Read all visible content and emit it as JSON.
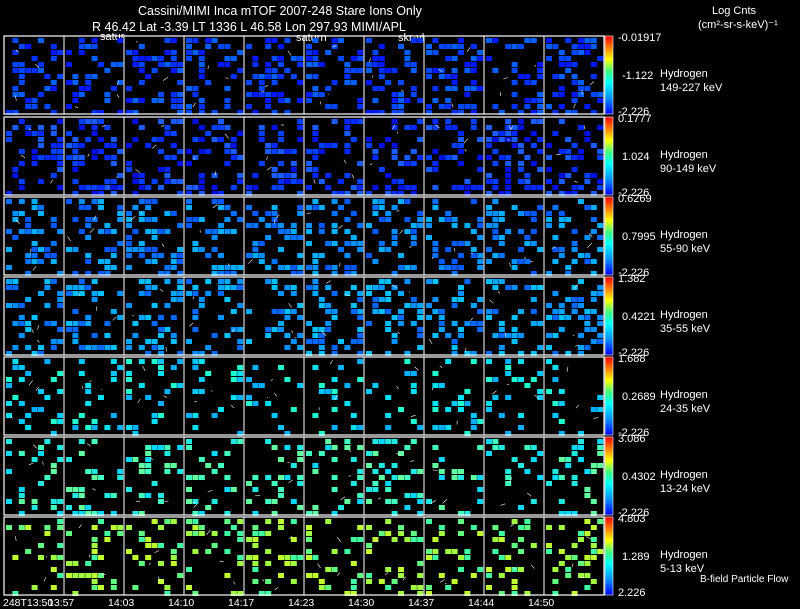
{
  "header": {
    "title": "Cassini/MIMI Inca mTOF  2007-248   Stare   Ions Only",
    "pos_line": "R         46.42 Lat -3.39 LT 1336 L         46.58 Lon         297.93  MIMI/APL",
    "cb_title": "Log Cnts",
    "cb_units": "(cm²-sr-s-keV)⁻¹",
    "marks": [
      "satur",
      "saturn",
      "skr-vl"
    ]
  },
  "footer": {
    "bfield": "B-field Particle Flow"
  },
  "colors": {
    "background": "#000000",
    "grid": "#ffffff",
    "text": "#ffffff"
  },
  "chart_data": {
    "type": "heatmap",
    "time_ticks": [
      "248T13:50",
      "13:57",
      "14:03",
      "14:10",
      "14:17",
      "14:23",
      "14:30",
      "14:37",
      "14:44",
      "14:50"
    ],
    "panels": [
      {
        "species": "Hydrogen",
        "energy": "149-227 keV",
        "cb_max": "-0.01917",
        "cb_mid": "-1.122",
        "cb_min": "-2.226"
      },
      {
        "species": "Hydrogen",
        "energy": "90-149 keV",
        "cb_max": "0.1777",
        "cb_mid": "1.024",
        "cb_min": "-2.226"
      },
      {
        "species": "Hydrogen",
        "energy": "55-90 keV",
        "cb_max": "0.6269",
        "cb_mid": "0.7995",
        "cb_min": "-2.226"
      },
      {
        "species": "Hydrogen",
        "energy": "35-55 keV",
        "cb_max": "1.382",
        "cb_mid": "0.4221",
        "cb_min": "-2.226"
      },
      {
        "species": "Hydrogen",
        "energy": "24-35 keV",
        "cb_max": "1.688",
        "cb_mid": "0.2689",
        "cb_min": "-2.226"
      },
      {
        "species": "Hydrogen",
        "energy": "13-24 keV",
        "cb_max": "3.086",
        "cb_mid": "0.4302",
        "cb_min": "-2.226"
      },
      {
        "species": "Hydrogen",
        "energy": "5-13 keV",
        "cb_max": "4.803",
        "cb_mid": "1.289",
        "cb_min": "2.226"
      }
    ]
  }
}
